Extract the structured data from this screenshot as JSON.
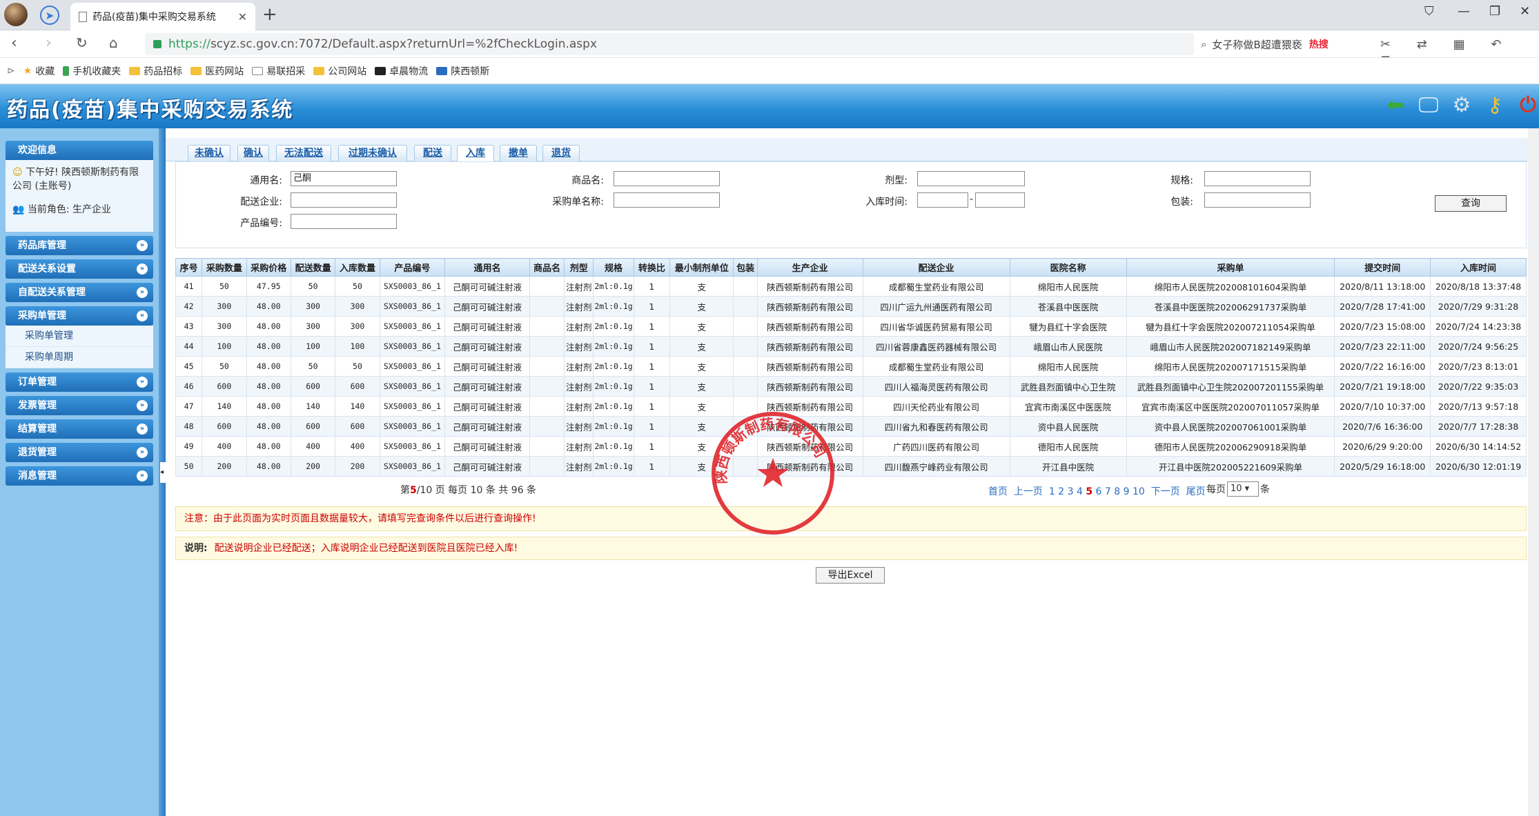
{
  "browser": {
    "tab_title": "药品(疫苗)集中采购交易系统",
    "url_https": "https://",
    "url_rest": "scyz.sc.gov.cn:7072/Default.aspx?returnUrl=%2fCheckLogin.aspx",
    "search_text": "女子称做B超遭猥亵",
    "search_hot": "热搜",
    "bookmarks": [
      "收藏",
      "手机收藏夹",
      "药品招标",
      "医药网站",
      "易联招采",
      "公司网站",
      "卓晨物流",
      "陕西顿斯"
    ]
  },
  "app": {
    "title": "药品(疫苗)集中采购交易系统"
  },
  "sidebar": {
    "welcome_title": "欢迎信息",
    "greeting": "下午好! 陕西顿斯制药有限公司 (主账号)",
    "role": "当前角色: 生产企业",
    "menus": [
      {
        "label": "药品库管理"
      },
      {
        "label": "配送关系设置"
      },
      {
        "label": "自配送关系管理"
      },
      {
        "label": "采购单管理"
      },
      {
        "label": "订单管理"
      },
      {
        "label": "发票管理"
      },
      {
        "label": "结算管理"
      },
      {
        "label": "退货管理"
      },
      {
        "label": "消息管理"
      }
    ],
    "submenu": [
      "采购单管理",
      "采购单周期"
    ]
  },
  "tabs": [
    "未确认",
    "确认",
    "无法配送",
    "过期未确认",
    "配送",
    "入库",
    "撤单",
    "退货"
  ],
  "active_tab": "入库",
  "form": {
    "generic_name_label": "通用名:",
    "generic_name_value": "己酮",
    "trade_name_label": "商品名:",
    "dosage_label": "剂型:",
    "spec_label": "规格:",
    "dist_label": "配送企业:",
    "po_name_label": "采购单名称:",
    "storage_time_label": "入库时间:",
    "storage_sep": "-",
    "package_label": "包装:",
    "product_code_label": "产品编号:",
    "query_button": "查询"
  },
  "table": {
    "headers": [
      "序号",
      "采购数量",
      "采购价格",
      "配送数量",
      "入库数量",
      "产品编号",
      "通用名",
      "商品名",
      "剂型",
      "规格",
      "转换比",
      "最小制剂单位",
      "包装",
      "生产企业",
      "配送企业",
      "医院名称",
      "采购单",
      "提交时间",
      "入库时间"
    ],
    "rows": [
      [
        "41",
        "50",
        "47.95",
        "50",
        "50",
        "SXS0003_86_1",
        "己酮可可碱注射液",
        "",
        "注射剂",
        "2ml:0.1g",
        "1",
        "支",
        "",
        "陕西顿斯制药有限公司",
        "成都蜀生堂药业有限公司",
        "绵阳市人民医院",
        "绵阳市人民医院202008101604采购单",
        "2020/8/11 13:18:00",
        "2020/8/18 13:37:48"
      ],
      [
        "42",
        "300",
        "48.00",
        "300",
        "300",
        "SXS0003_86_1",
        "己酮可可碱注射液",
        "",
        "注射剂",
        "2ml:0.1g",
        "1",
        "支",
        "",
        "陕西顿斯制药有限公司",
        "四川广运九州通医药有限公司",
        "苍溪县中医医院",
        "苍溪县中医医院202006291737采购单",
        "2020/7/28 17:41:00",
        "2020/7/29 9:31:28"
      ],
      [
        "43",
        "300",
        "48.00",
        "300",
        "300",
        "SXS0003_86_1",
        "己酮可可碱注射液",
        "",
        "注射剂",
        "2ml:0.1g",
        "1",
        "支",
        "",
        "陕西顿斯制药有限公司",
        "四川省华诚医药贸易有限公司",
        "犍为县红十字会医院",
        "犍为县红十字会医院202007211054采购单",
        "2020/7/23 15:08:00",
        "2020/7/24 14:23:38"
      ],
      [
        "44",
        "100",
        "48.00",
        "100",
        "100",
        "SXS0003_86_1",
        "己酮可可碱注射液",
        "",
        "注射剂",
        "2ml:0.1g",
        "1",
        "支",
        "",
        "陕西顿斯制药有限公司",
        "四川省蓉康鑫医药器械有限公司",
        "峨眉山市人民医院",
        "峨眉山市人民医院202007182149采购单",
        "2020/7/23 22:11:00",
        "2020/7/24 9:56:25"
      ],
      [
        "45",
        "50",
        "48.00",
        "50",
        "50",
        "SXS0003_86_1",
        "己酮可可碱注射液",
        "",
        "注射剂",
        "2ml:0.1g",
        "1",
        "支",
        "",
        "陕西顿斯制药有限公司",
        "成都蜀生堂药业有限公司",
        "绵阳市人民医院",
        "绵阳市人民医院202007171515采购单",
        "2020/7/22 16:16:00",
        "2020/7/23 8:13:01"
      ],
      [
        "46",
        "600",
        "48.00",
        "600",
        "600",
        "SXS0003_86_1",
        "己酮可可碱注射液",
        "",
        "注射剂",
        "2ml:0.1g",
        "1",
        "支",
        "",
        "陕西顿斯制药有限公司",
        "四川人福海灵医药有限公司",
        "武胜县烈面镇中心卫生院",
        "武胜县烈面镇中心卫生院202007201155采购单",
        "2020/7/21 19:18:00",
        "2020/7/22 9:35:03"
      ],
      [
        "47",
        "140",
        "48.00",
        "140",
        "140",
        "SXS0003_86_1",
        "己酮可可碱注射液",
        "",
        "注射剂",
        "2ml:0.1g",
        "1",
        "支",
        "",
        "陕西顿斯制药有限公司",
        "四川天伦药业有限公司",
        "宜宾市南溪区中医医院",
        "宜宾市南溪区中医医院202007011057采购单",
        "2020/7/10 10:37:00",
        "2020/7/13 9:57:18"
      ],
      [
        "48",
        "600",
        "48.00",
        "600",
        "600",
        "SXS0003_86_1",
        "己酮可可碱注射液",
        "",
        "注射剂",
        "2ml:0.1g",
        "1",
        "支",
        "",
        "陕西顿斯制药有限公司",
        "四川省九和春医药有限公司",
        "资中县人民医院",
        "资中县人民医院202007061001采购单",
        "2020/7/6 16:36:00",
        "2020/7/7 17:28:38"
      ],
      [
        "49",
        "400",
        "48.00",
        "400",
        "400",
        "SXS0003_86_1",
        "己酮可可碱注射液",
        "",
        "注射剂",
        "2ml:0.1g",
        "1",
        "支",
        "",
        "陕西顿斯制药有限公司",
        "广药四川医药有限公司",
        "德阳市人民医院",
        "德阳市人民医院202006290918采购单",
        "2020/6/29 9:20:00",
        "2020/6/30 14:14:52"
      ],
      [
        "50",
        "200",
        "48.00",
        "200",
        "200",
        "SXS0003_86_1",
        "己酮可可碱注射液",
        "",
        "注射剂",
        "2ml:0.1g",
        "1",
        "支",
        "",
        "陕西顿斯制药有限公司",
        "四川馥燕宁峰药业有限公司",
        "开江县中医院",
        "开江县中医院202005221609采购单",
        "2020/5/29 16:18:00",
        "2020/6/30 12:01:19"
      ]
    ]
  },
  "pager": {
    "summary_prefix": "第",
    "current_page": "5",
    "summary_suffix": "/10 页 每页 10 条 共 96 条",
    "first": "首页",
    "prev": "上一页",
    "pages": [
      "1",
      "2",
      "3",
      "4",
      "5",
      "6",
      "7",
      "8",
      "9",
      "10"
    ],
    "next": "下一页",
    "last": "尾页",
    "per_page_label": "每页",
    "per_page_value": "10",
    "per_page_unit": "条"
  },
  "notice": "注意：由于此页面为实时页面且数据量较大，请填写完查询条件以后进行查询操作!",
  "explain_label": "说明:",
  "explain_text": "配送说明企业已经配送；入库说明企业已经配送到医院且医院已经入库!",
  "export_button": "导出Excel",
  "seal_text": "陕西顿斯制药有限公司",
  "colors": {
    "header_blue": "#2b8fd8",
    "seal_red": "#e0262b",
    "alert_red": "#cc0000"
  }
}
